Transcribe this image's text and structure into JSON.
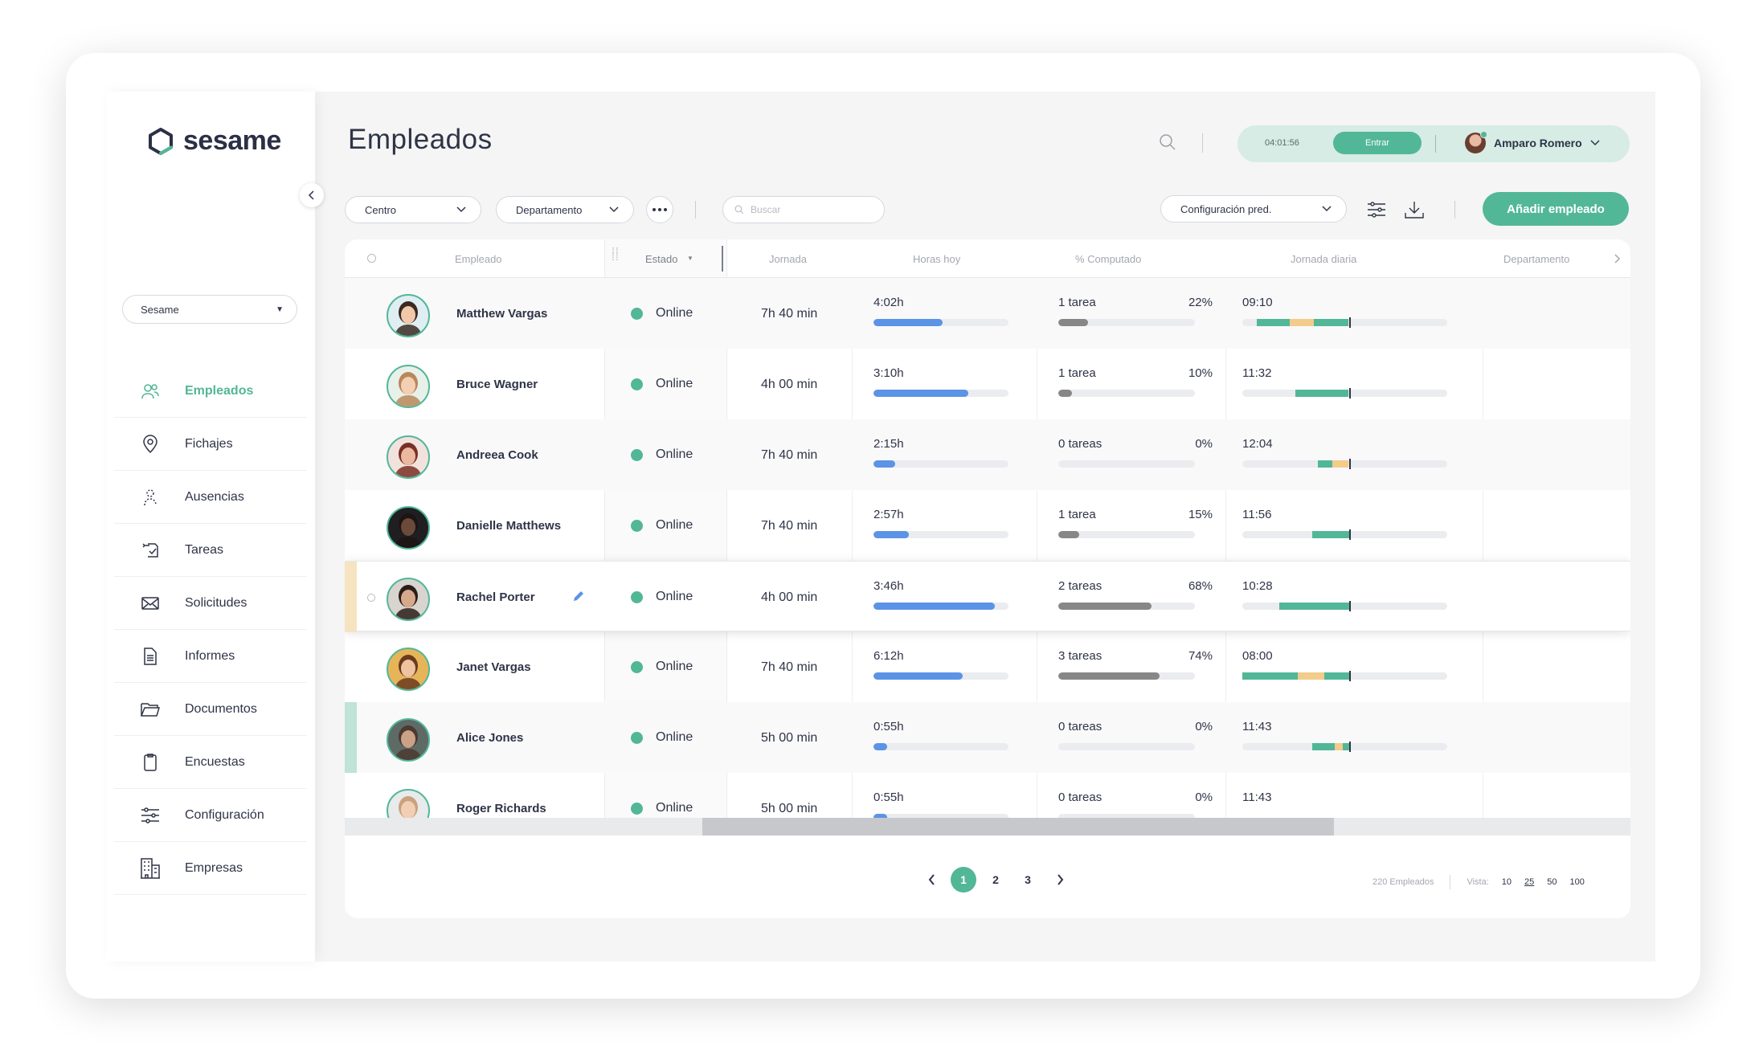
{
  "app": {
    "brand": "sesame",
    "page_title": "Empleados"
  },
  "sidebar": {
    "company": "Sesame",
    "items": [
      {
        "label": "Empleados",
        "icon": "users-icon",
        "active": true
      },
      {
        "label": "Fichajes",
        "icon": "location-pin-icon",
        "active": false
      },
      {
        "label": "Ausencias",
        "icon": "person-dashed-icon",
        "active": false
      },
      {
        "label": "Tareas",
        "icon": "tasks-icon",
        "active": false
      },
      {
        "label": "Solicitudes",
        "icon": "envelope-icon",
        "active": false
      },
      {
        "label": "Informes",
        "icon": "document-icon",
        "active": false
      },
      {
        "label": "Documentos",
        "icon": "folder-icon",
        "active": false
      },
      {
        "label": "Encuestas",
        "icon": "clipboard-icon",
        "active": false
      },
      {
        "label": "Configuración",
        "icon": "sliders-icon",
        "active": false
      },
      {
        "label": "Empresas",
        "icon": "building-icon",
        "active": false
      }
    ]
  },
  "header": {
    "clock_time": "04:01:56",
    "clock_button": "Entrar",
    "user_name": "Amparo Romero"
  },
  "toolbar": {
    "filter_center": "Centro",
    "filter_department": "Departamento",
    "search_placeholder": "Buscar",
    "config_select": "Configuración pred.",
    "add_button": "Añadir empleado"
  },
  "table": {
    "columns": {
      "empleado": "Empleado",
      "estado": "Estado",
      "jornada": "Jornada",
      "horas_hoy": "Horas hoy",
      "computado": "% Computado",
      "jornada_diaria": "Jornada diaria",
      "departamento": "Departamento"
    },
    "rows": [
      {
        "name": "Matthew Vargas",
        "status": "Online",
        "jornada": "7h 40 min",
        "hours": "4:02h",
        "hours_fraction": 0.51,
        "tasks": "1 tarea",
        "pct": "22%",
        "pct_value": 22,
        "daily": "09:10",
        "marker": ""
      },
      {
        "name": "Bruce Wagner",
        "status": "Online",
        "jornada": "4h 00 min",
        "hours": "3:10h",
        "hours_fraction": 0.7,
        "tasks": "1 tarea",
        "pct": "10%",
        "pct_value": 10,
        "daily": "11:32",
        "marker": ""
      },
      {
        "name": "Andreea Cook",
        "status": "Online",
        "jornada": "7h 40 min",
        "hours": "2:15h",
        "hours_fraction": 0.16,
        "tasks": "0 tareas",
        "pct": "0%",
        "pct_value": 0,
        "daily": "12:04",
        "marker": ""
      },
      {
        "name": "Danielle Matthews",
        "status": "Online",
        "jornada": "7h 40 min",
        "hours": "2:57h",
        "hours_fraction": 0.26,
        "tasks": "1 tarea",
        "pct": "15%",
        "pct_value": 15,
        "daily": "11:56",
        "marker": ""
      },
      {
        "name": "Rachel Porter",
        "status": "Online",
        "jornada": "4h 00 min",
        "hours": "3:46h",
        "hours_fraction": 0.9,
        "tasks": "2 tareas",
        "pct": "68%",
        "pct_value": 68,
        "daily": "10:28",
        "marker": "#f6e3c0"
      },
      {
        "name": "Janet Vargas",
        "status": "Online",
        "jornada": "7h 40 min",
        "hours": "6:12h",
        "hours_fraction": 0.66,
        "tasks": "3 tareas",
        "pct": "74%",
        "pct_value": 74,
        "daily": "08:00",
        "marker": ""
      },
      {
        "name": "Alice Jones",
        "status": "Online",
        "jornada": "5h 00 min",
        "hours": "0:55h",
        "hours_fraction": 0.1,
        "tasks": "0 tareas",
        "pct": "0%",
        "pct_value": 0,
        "daily": "11:43",
        "marker": "#bfe3d6"
      },
      {
        "name": "Roger Richards",
        "status": "Online",
        "jornada": "5h 00 min",
        "hours": "0:55h",
        "hours_fraction": 0.1,
        "tasks": "0 tareas",
        "pct": "0%",
        "pct_value": 0,
        "daily": "11:43",
        "marker": ""
      }
    ]
  },
  "footer": {
    "pages": [
      "1",
      "2",
      "3"
    ],
    "current_page": "1",
    "total": "220 Empleados",
    "view_label": "Vista:",
    "view_options": [
      "10",
      "25",
      "50",
      "100"
    ],
    "view_selected": "25"
  },
  "colors": {
    "accent": "#52b797",
    "blue_bar": "#5b93e6",
    "gray_bar": "#878787",
    "orange_segment": "#f3cb8b"
  }
}
